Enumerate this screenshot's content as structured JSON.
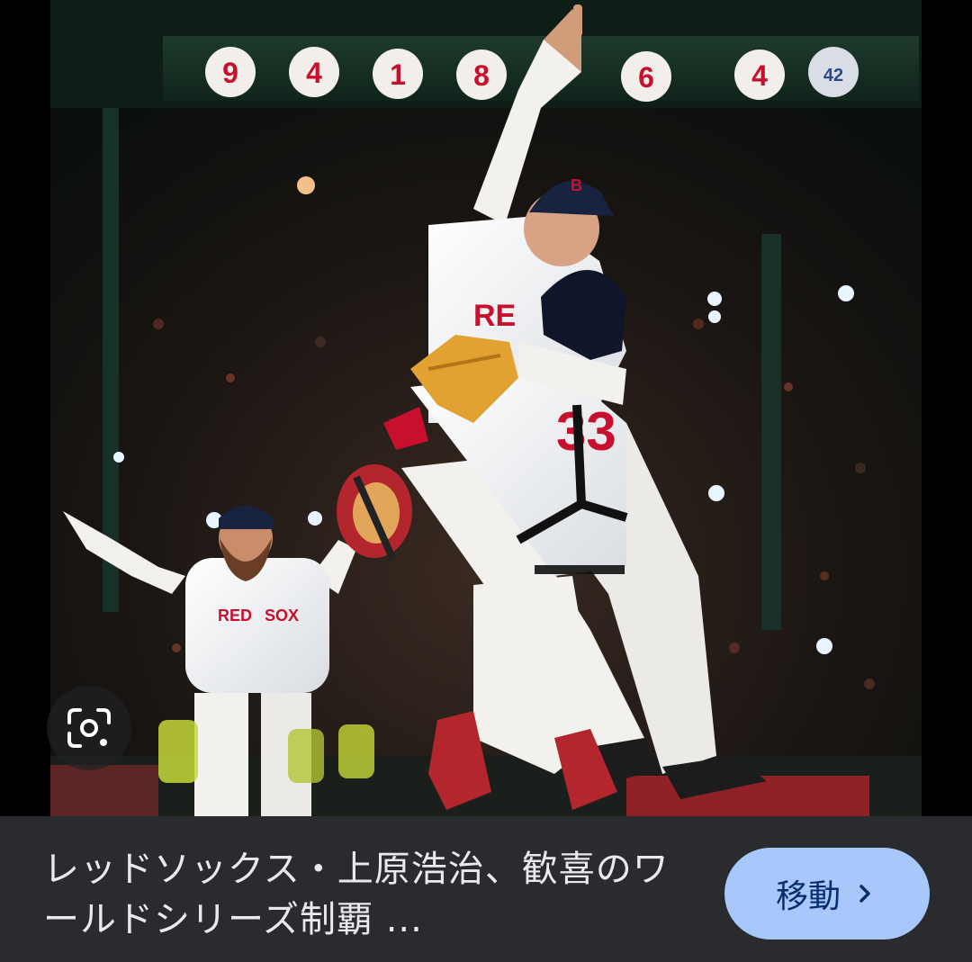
{
  "image": {
    "subject": "photo",
    "retired_numbers": [
      "9",
      "4",
      "1",
      "8",
      "6",
      "4",
      "42"
    ],
    "jersey_text": "RED SOX",
    "jersey_number": "33"
  },
  "lens_button": {
    "icon": "google-lens-icon"
  },
  "result": {
    "title": "レッドソックス・上原浩治、歓喜のワールドシリーズ制覇 ..."
  },
  "goto_button": {
    "label": "移動",
    "icon": "chevron-right-icon"
  },
  "colors": {
    "bottom_bar": "#2a2b2e",
    "caption_text": "#e8eaed",
    "button_bg": "#a8c7fa",
    "button_text": "#062e6f"
  }
}
